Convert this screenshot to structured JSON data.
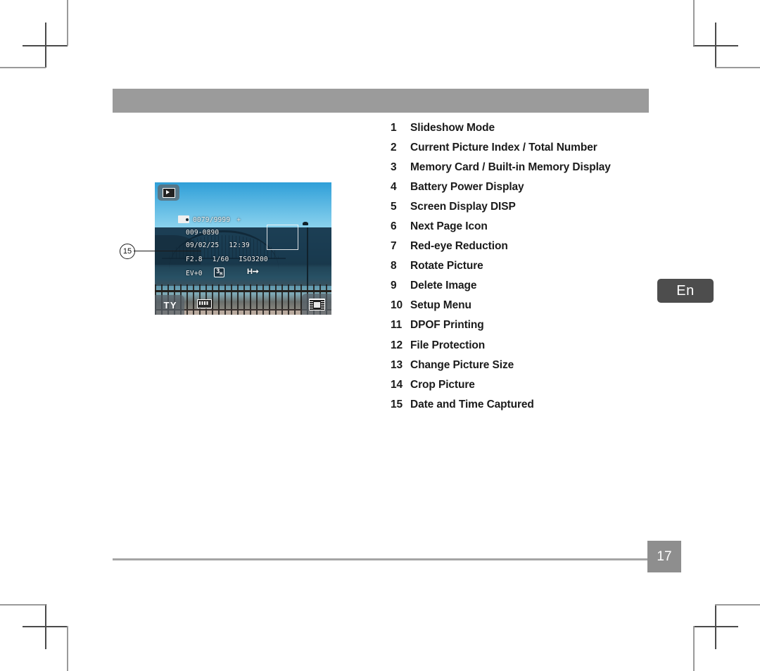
{
  "document": {
    "page_number": "17",
    "language_tab": "En"
  },
  "legend": {
    "items": [
      {
        "num": "1",
        "label": "Slideshow Mode"
      },
      {
        "num": "2",
        "label": "Current Picture Index / Total Number"
      },
      {
        "num": "3",
        "label": "Memory Card / Built-in Memory Display"
      },
      {
        "num": "4",
        "label": "Battery Power Display"
      },
      {
        "num": "5",
        "label": "Screen Display DISP"
      },
      {
        "num": "6",
        "label": "Next Page Icon"
      },
      {
        "num": "7",
        "label": "Red-eye Reduction"
      },
      {
        "num": "8",
        "label": "Rotate Picture"
      },
      {
        "num": "9",
        "label": "Delete Image"
      },
      {
        "num": "10",
        "label": "Setup Menu"
      },
      {
        "num": "11",
        "label": "DPOF Printing"
      },
      {
        "num": "12",
        "label": "File Protection"
      },
      {
        "num": "13",
        "label": "Change Picture Size"
      },
      {
        "num": "14",
        "label": "Crop Picture"
      },
      {
        "num": "15",
        "label": "Date and Time Captured"
      }
    ]
  },
  "callout": {
    "number": "15"
  },
  "lcd": {
    "osd": {
      "index_total": "0079/9999",
      "plus_mark": "+",
      "folder_file": "009-0890",
      "date": "09/02/25",
      "time": "12:39",
      "aperture": "F2.8",
      "shutter": "1/60",
      "iso": "ISO3200",
      "ev": "EV+0",
      "resolution": "3",
      "resolution_unit": "M",
      "hdr": "H"
    },
    "badges": {
      "bottom_left": "T Y"
    }
  },
  "colors": {
    "header_band": "#9b9b9b",
    "page_badge": "#8e8e8e",
    "lang_tab": "#4d4d4d",
    "footer_rule": "#a5a5a5",
    "crop_mark": "#4a4a4a"
  }
}
